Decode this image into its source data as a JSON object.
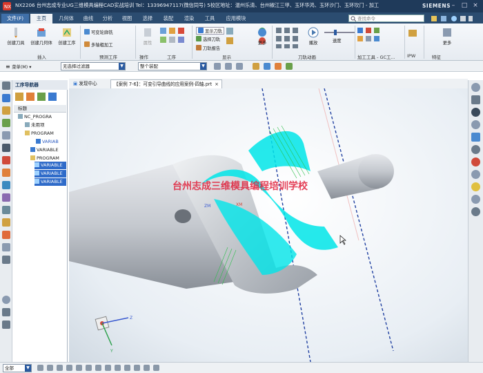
{
  "titlebar": {
    "title": "NX2206 台州志成专业UG三维模具编程CAD实战培训 Tel：13396947117(微信同号) 5校区地址：温州乐清、台州椒江三甲、玉环华鸿、玉环沙门、玉环坎门 - 加工",
    "brand": "SIEMENS"
  },
  "tabs": [
    "文件(F)",
    "主页",
    "几何体",
    "曲线",
    "分析",
    "视图",
    "选择",
    "装配",
    "渲染",
    "工具",
    "应用模块"
  ],
  "search_placeholder": "查找命令",
  "ribbon": {
    "buttons": [
      "创建刀具",
      "创建几何体",
      "创建工序"
    ],
    "small_buttons": [
      "可变轮廓铣",
      "多轴粗加工"
    ],
    "attribute_label": "属性",
    "display_toggles": [
      "显示刀轨",
      "选择刀轨",
      "刀轨报告"
    ],
    "more": "更多",
    "play": "播放",
    "speed": "速度",
    "groups": [
      "插入",
      "预测工序",
      "操作",
      "工序",
      "显示",
      "刀轨动画",
      "加工工具 - GC工...",
      "IPW",
      "特征"
    ]
  },
  "toolbar": {
    "menu": "菜单(M)",
    "filter": "无选择过滤器",
    "scope": "整个装配"
  },
  "doc_tabs": [
    "发现中心",
    "【案例 7-6】：可变引导曲线的应用案例-四轴.prt"
  ],
  "navigator": {
    "title": "工序导航器",
    "column": "标题",
    "items": [
      "NC_PROGRA",
      "未用项",
      "PROGRAM",
      "VARIAB",
      "VARIABLE",
      "PROGRAM",
      "VARIABLE",
      "VARIABLE",
      "VARIABLE"
    ]
  },
  "viewport": {
    "watermark": "台州志成三维模具编程培训学校",
    "axis_labels": [
      "ZM",
      "XM"
    ],
    "triad": [
      "Z",
      "X",
      "Y"
    ]
  },
  "statusbar": {
    "selector": "全部"
  },
  "colors": {
    "title_bg": "#1f3a5a",
    "tab_bg": "#2b4c70",
    "file_tab": "#3f6fa8",
    "toolpath": "#00e5e8",
    "watermark": "#e0203a",
    "selection": "#2f6bc9"
  }
}
